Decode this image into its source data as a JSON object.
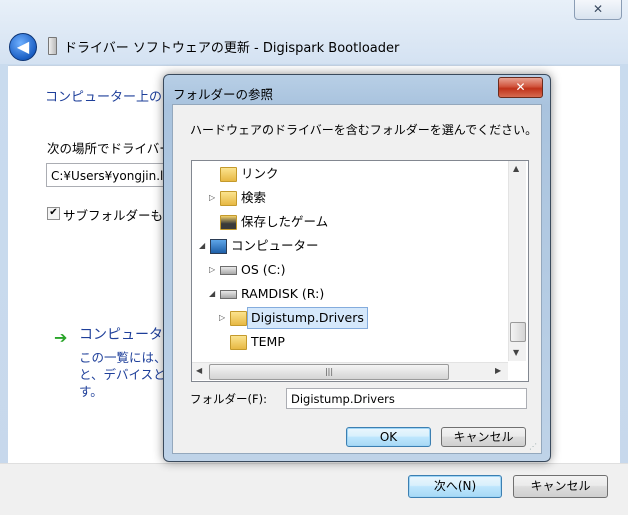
{
  "wizard": {
    "title": "ドライバー ソフトウェアの更新 - Digispark Bootloader",
    "close_glyph": "✕",
    "heading": "コンピューター上のド",
    "search_label": "次の場所でドライバー",
    "path_value": "C:¥Users¥yongjin.le",
    "subfolder_label": "サブフォルダーも村",
    "subfolder_checked": true,
    "pick_title": "コンピューター",
    "pick_desc": [
      "この一覧には、",
      "と、デバイスと",
      "す。"
    ],
    "next_label": "次へ(N)",
    "cancel_label": "キャンセル"
  },
  "dialog": {
    "title": "フォルダーの参照",
    "close_glyph": "✕",
    "instruction": "ハードウェアのドライバーを含むフォルダーを選んでください。",
    "tree": [
      {
        "label": "リンク",
        "icon": "link-folder-icon",
        "level": 1,
        "expander": ""
      },
      {
        "label": "検索",
        "icon": "search-folder-icon",
        "level": 1,
        "expander": "▷"
      },
      {
        "label": "保存したゲーム",
        "icon": "saved-games-folder-icon",
        "level": 1,
        "expander": ""
      },
      {
        "label": "コンピューター",
        "icon": "computer-icon",
        "level": 0,
        "expander": "◢"
      },
      {
        "label": "OS (C:)",
        "icon": "os-drive-icon",
        "level": 1,
        "expander": "▷"
      },
      {
        "label": "RAMDISK (R:)",
        "icon": "drive-icon",
        "level": 1,
        "expander": "◢"
      },
      {
        "label": "Digistump.Drivers",
        "icon": "folder-icon",
        "level": 2,
        "expander": "▷",
        "selected": true
      },
      {
        "label": "TEMP",
        "icon": "folder-icon",
        "level": 2,
        "expander": ""
      }
    ],
    "folder_label": "フォルダー(F):",
    "folder_value": "Digistump.Drivers",
    "ok_label": "OK",
    "cancel_label": "キャンセル"
  }
}
